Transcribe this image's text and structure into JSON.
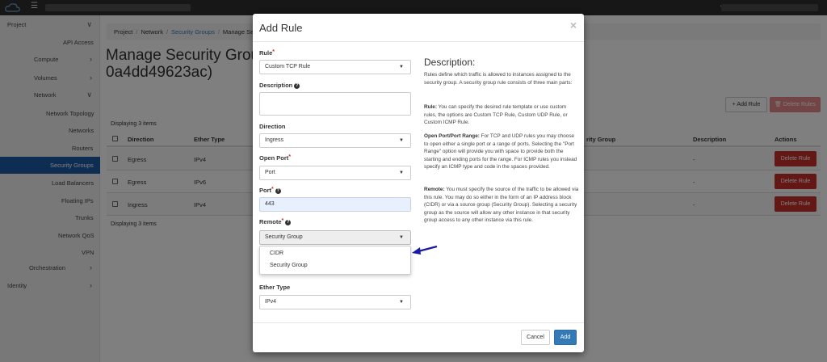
{
  "colors": {
    "primary": "#337ab7",
    "danger": "#c9302c",
    "sidebar_active": "#1d5aa5",
    "annotation_arrow": "#1a1aa6"
  },
  "topbar": {
    "menu_icon": "hamburger-icon",
    "logo_icon": "cloud-logo"
  },
  "sidebar": {
    "items": [
      {
        "label": "Project",
        "has_chevron": true,
        "chevron": "∨"
      },
      {
        "label": "API Access"
      },
      {
        "label": "Compute",
        "has_chevron": true,
        "chevron": "›"
      },
      {
        "label": "Volumes",
        "has_chevron": true,
        "chevron": "›"
      },
      {
        "label": "Network",
        "has_chevron": true,
        "chevron": "∨"
      },
      {
        "label": "Network Topology"
      },
      {
        "label": "Networks"
      },
      {
        "label": "Routers"
      },
      {
        "label": "Security Groups",
        "active": true
      },
      {
        "label": "Load Balancers"
      },
      {
        "label": "Floating IPs"
      },
      {
        "label": "Trunks"
      },
      {
        "label": "Network QoS"
      },
      {
        "label": "VPN"
      },
      {
        "label": "Orchestration",
        "has_chevron": true,
        "chevron": "›"
      },
      {
        "label": "Identity",
        "has_chevron": true,
        "chevron": "›"
      }
    ]
  },
  "breadcrumb": {
    "items": [
      "Project",
      "Network",
      "Security Groups",
      "Manage Se"
    ]
  },
  "page": {
    "title": "Manage Security Grou… 0a4dd49623ac)",
    "title_line1": "Manage Security Grou",
    "title_line2": "0a4dd49623ac)"
  },
  "toolbar": {
    "add_rule": "+ Add Rule",
    "delete_rules": "🗑 Delete Rules"
  },
  "table": {
    "displaying_top": "Displaying 3 items",
    "displaying_bottom": "Displaying 3 items",
    "headers": {
      "direction": "Direction",
      "ether_type": "Ether Type",
      "remote_group": "rity Group",
      "description": "Description",
      "actions": "Actions"
    },
    "rows": [
      {
        "direction": "Egress",
        "ether_type": "IPv4",
        "description": "-",
        "action": "Delete Rule"
      },
      {
        "direction": "Egress",
        "ether_type": "IPv6",
        "description": "-",
        "action": "Delete Rule"
      },
      {
        "direction": "Ingress",
        "ether_type": "IPv4",
        "description": "-",
        "action": "Delete Rule"
      }
    ]
  },
  "modal": {
    "title": "Add Rule",
    "close": "×",
    "fields": {
      "rule": {
        "label": "Rule",
        "value": "Custom TCP Rule"
      },
      "description": {
        "label": "Description",
        "value": ""
      },
      "direction": {
        "label": "Direction",
        "value": "Ingress"
      },
      "open_port": {
        "label": "Open Port",
        "value": "Port"
      },
      "port": {
        "label": "Port",
        "value": "443"
      },
      "remote": {
        "label": "Remote",
        "value": "Security Group",
        "options": [
          "CIDR",
          "Security Group"
        ]
      },
      "ether_type": {
        "label": "Ether Type",
        "value": "IPv4"
      }
    },
    "required_mark": "*",
    "help_mark": "?",
    "caret": "▼",
    "description_panel": {
      "title": "Description:",
      "intro": "Rules define which traffic is allowed to instances assigned to the security group. A security group rule consists of three main parts:",
      "rule_head": "Rule:",
      "rule_text": " You can specify the desired rule template or use custom rules, the options are Custom TCP Rule, Custom UDP Rule, or Custom ICMP Rule.",
      "port_head": "Open Port/Port Range:",
      "port_text": " For TCP and UDP rules you may choose to open either a single port or a range of ports. Selecting the \"Port Range\" option will provide you with space to provide both the starting and ending ports for the range. For ICMP rules you instead specify an ICMP type and code in the spaces provided.",
      "remote_head": "Remote:",
      "remote_text": " You must specify the source of the traffic to be allowed via this rule. You may do so either in the form of an IP address block (CIDR) or via a source group (Security Group). Selecting a security group as the source will allow any other instance in that security group access to any other instance via this rule."
    },
    "buttons": {
      "cancel": "Cancel",
      "add": "Add"
    }
  }
}
